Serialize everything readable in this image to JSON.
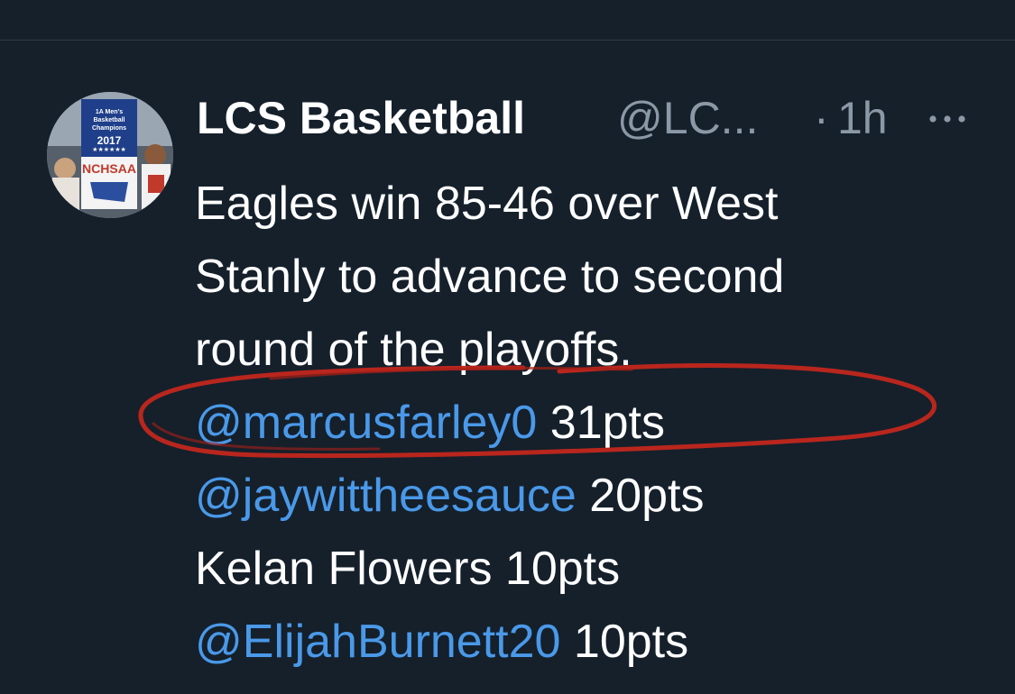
{
  "tweet": {
    "display_name": "LCS Basketball",
    "handle": "@LC...",
    "separator": "·",
    "time": "1h",
    "more_icon": "ellipsis-icon",
    "avatar": {
      "banner_line1": "1A Men's",
      "banner_line2": "Basketball",
      "banner_line3": "Champions",
      "banner_year": "2017",
      "banner_org": "NCHSAA"
    },
    "text_lines": [
      "Eagles win 85-46 over West",
      "Stanly to advance to second",
      "round of the playoffs."
    ],
    "scorers": [
      {
        "mention": "@marcusfarley0",
        "plain_name": "",
        "points": "31pts"
      },
      {
        "mention": "@jaywittheesauce",
        "plain_name": "",
        "points": "20pts"
      },
      {
        "mention": "",
        "plain_name": "Kelan Flowers",
        "points": "10pts"
      },
      {
        "mention": "@ElijahBurnett20",
        "plain_name": "",
        "points": "10pts"
      }
    ]
  },
  "colors": {
    "background": "#15202b",
    "text": "#ffffff",
    "secondary_text": "#8b98a5",
    "mention": "#4a99e9",
    "annotation_circle": "#c2271c"
  }
}
